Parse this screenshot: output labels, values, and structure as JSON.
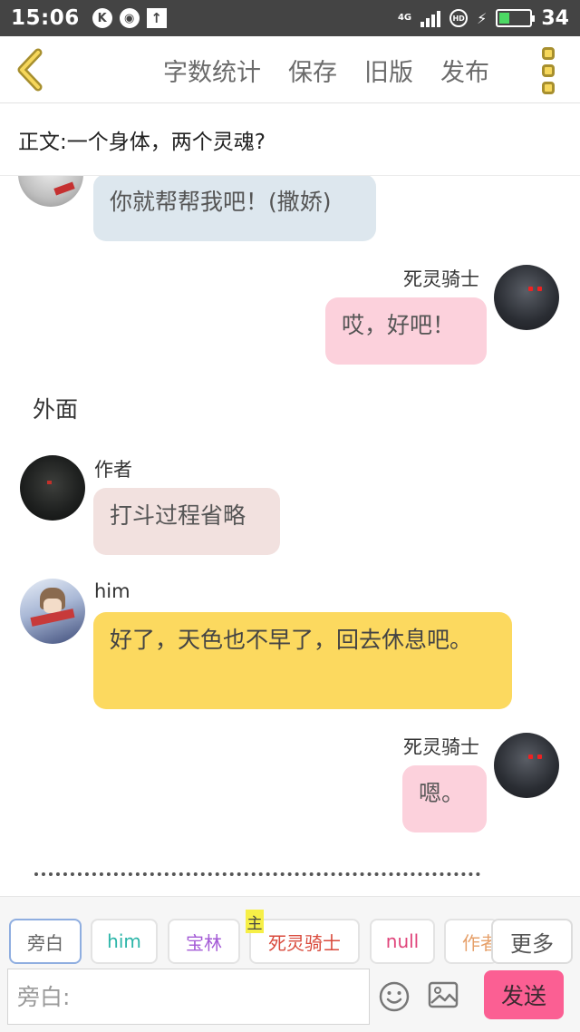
{
  "status_bar": {
    "time": "15:06",
    "icon_k": "K",
    "network": "4G",
    "hd": "HD",
    "battery_level": "34",
    "battery_fraction": 0.34,
    "battery_color": "#4cd964"
  },
  "nav": {
    "actions": [
      "字数统计",
      "保存",
      "旧版",
      "发布"
    ]
  },
  "title": "正文:一个身体，两个灵魂?",
  "messages": [
    {
      "side": "left",
      "avatar": "top-avatar",
      "text": "你就帮帮我吧！(撒娇)",
      "color": "#dde7ee"
    },
    {
      "side": "right",
      "name": "死灵骑士",
      "avatar": "knight-avatar",
      "text": "哎，好吧！",
      "color": "#fcd1dc"
    },
    {
      "type": "narration",
      "text": "外面"
    },
    {
      "side": "left",
      "name": "作者",
      "avatar": "author-avatar",
      "text": "打斗过程省略",
      "color": "#f2e1df"
    },
    {
      "side": "left",
      "name": "him",
      "avatar": "him-avatar",
      "text": "好了，天色也不早了，回去休息吧。",
      "color": "#fcd95f"
    },
    {
      "side": "right",
      "name": "死灵骑士",
      "avatar": "knight-avatar",
      "text": "嗯。",
      "color": "#fcd1dc"
    }
  ],
  "roles": {
    "items": [
      {
        "label": "旁白",
        "color": "#666666"
      },
      {
        "label": "him",
        "color": "#2bb5a8"
      },
      {
        "label": "宝林",
        "color": "#a45bd6"
      },
      {
        "label": "死灵骑士",
        "color": "#d94a3c"
      },
      {
        "label": "null",
        "color": "#e0457b"
      },
      {
        "label": "作者",
        "color": "#e6a06a"
      }
    ],
    "main_badge": "主",
    "more_label": "更多"
  },
  "input": {
    "placeholder": "旁白:",
    "send_label": "发送"
  },
  "colors": {
    "send_button": "#fb5f93",
    "accent_yellow": "#f6d75b"
  }
}
